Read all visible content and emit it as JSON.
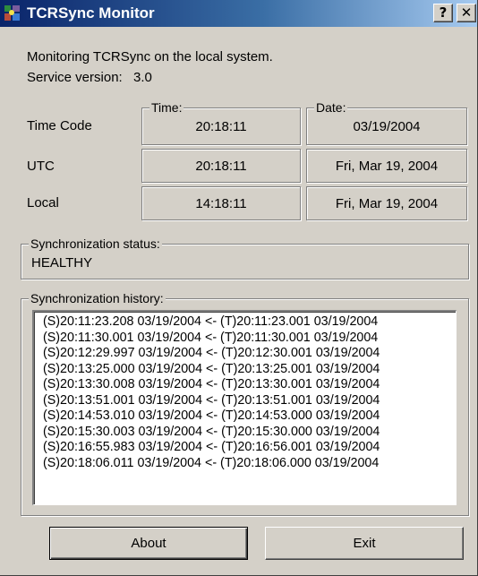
{
  "window": {
    "title": "TCRSync Monitor",
    "help_label": "?",
    "close_label": "✕",
    "app_icon": "tcrsync-app-icon",
    "title_bar_color": "#0a246a"
  },
  "info": {
    "monitoring_text": "Monitoring TCRSync on the local system.",
    "service_version_label": "Service version:",
    "service_version": "3.0"
  },
  "time_grid": {
    "time_header": "Time:",
    "date_header": "Date:",
    "rows": [
      {
        "label": "Time Code",
        "time": "20:18:11",
        "date": "03/19/2004"
      },
      {
        "label": "UTC",
        "time": "20:18:11",
        "date": "Fri, Mar 19, 2004"
      },
      {
        "label": "Local",
        "time": "14:18:11",
        "date": "Fri, Mar 19, 2004"
      }
    ]
  },
  "sync_status": {
    "label": "Synchronization status:",
    "value": "HEALTHY"
  },
  "sync_history": {
    "label": "Synchronization history:",
    "entries": [
      "(S)20:11:23.208 03/19/2004 <- (T)20:11:23.001 03/19/2004",
      "(S)20:11:30.001 03/19/2004 <- (T)20:11:30.001 03/19/2004",
      "(S)20:12:29.997 03/19/2004 <- (T)20:12:30.001 03/19/2004",
      "(S)20:13:25.000 03/19/2004 <- (T)20:13:25.001 03/19/2004",
      "(S)20:13:30.008 03/19/2004 <- (T)20:13:30.001 03/19/2004",
      "(S)20:13:51.001 03/19/2004 <- (T)20:13:51.001 03/19/2004",
      "(S)20:14:53.010 03/19/2004 <- (T)20:14:53.000 03/19/2004",
      "(S)20:15:30.003 03/19/2004 <- (T)20:15:30.000 03/19/2004",
      "(S)20:16:55.983 03/19/2004 <- (T)20:16:56.001 03/19/2004",
      "(S)20:18:06.011 03/19/2004 <- (T)20:18:06.000 03/19/2004"
    ]
  },
  "buttons": {
    "about_label": "About",
    "exit_label": "Exit"
  }
}
